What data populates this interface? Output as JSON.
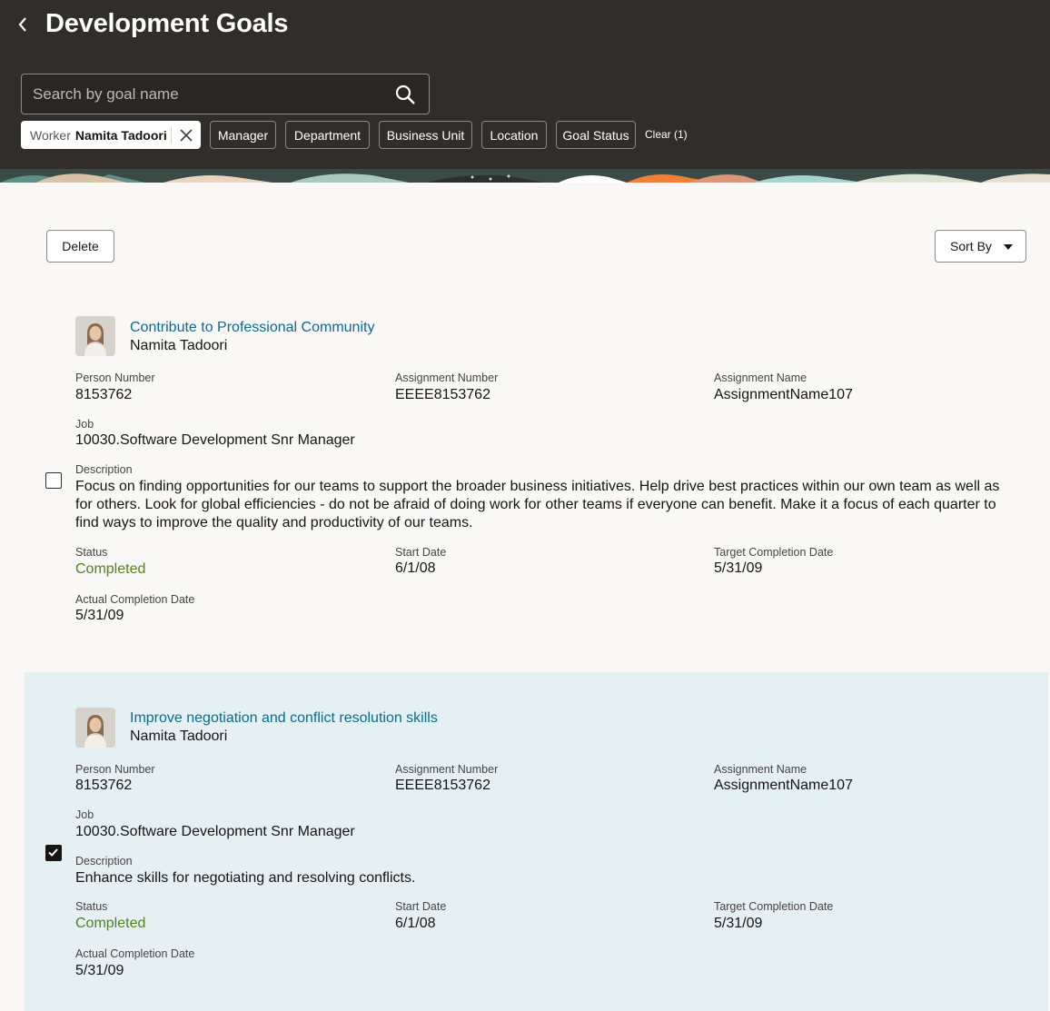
{
  "header": {
    "title": "Development Goals",
    "search": {
      "placeholder": "Search by goal name",
      "value": ""
    },
    "filters": {
      "worker": {
        "key": "Worker",
        "value": "Namita Tadoori"
      },
      "chips": [
        "Manager",
        "Department",
        "Business Unit",
        "Location",
        "Goal Status"
      ],
      "clear_label": "Clear (1)"
    }
  },
  "toolbar": {
    "delete_label": "Delete",
    "sort_label": "Sort By"
  },
  "labels": {
    "person_number": "Person Number",
    "assignment_number": "Assignment Number",
    "assignment_name": "Assignment Name",
    "job": "Job",
    "description": "Description",
    "status": "Status",
    "start_date": "Start Date",
    "target_completion_date": "Target Completion Date",
    "actual_completion_date": "Actual Completion Date"
  },
  "goals": [
    {
      "title": "Contribute to Professional Community",
      "person": "Namita Tadoori",
      "person_number": "8153762",
      "assignment_number": "EEEE8153762",
      "assignment_name": "AssignmentName107",
      "job": "10030.Software Development Snr Manager",
      "description": "Focus on finding opportunities for our teams to support the broader business initiatives. Help drive best practices within our own team as well as for others. Look for global efficiencies - do not be afraid of doing work for other teams if everyone can benefit. Make it a focus of each quarter to find ways to improve the quality and productivity of our teams.",
      "status": "Completed",
      "start_date": "6/1/08",
      "target_completion_date": "5/31/09",
      "actual_completion_date": "5/31/09",
      "selected": false
    },
    {
      "title": "Improve negotiation and conflict resolution skills",
      "person": "Namita Tadoori",
      "person_number": "8153762",
      "assignment_number": "EEEE8153762",
      "assignment_name": "AssignmentName107",
      "job": "10030.Software Development Snr Manager",
      "description": "Enhance skills for negotiating and resolving conflicts.",
      "status": "Completed",
      "start_date": "6/1/08",
      "target_completion_date": "5/31/09",
      "actual_completion_date": "5/31/09",
      "selected": true
    }
  ],
  "colors": {
    "header_bg": "#312d2a",
    "link": "#0e6a8c",
    "status_completed": "#508223",
    "selected_row": "#e5f0f5"
  },
  "icons": [
    "chevron-left-icon",
    "search-icon",
    "close-icon",
    "caret-down-icon",
    "checkmark-icon",
    "avatar-photo"
  ]
}
